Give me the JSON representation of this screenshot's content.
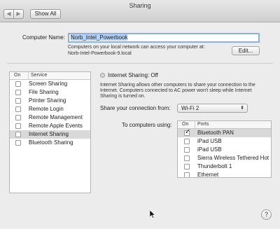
{
  "window": {
    "title": "Sharing",
    "nav_back": "◀",
    "nav_forward": "▶",
    "show_all": "Show All"
  },
  "computer_name": {
    "label": "Computer Name:",
    "value": "Norb_Intel_Powerbook",
    "info_line1": "Computers on your local network can access your computer at:",
    "info_line2": "Norb-Intel-Powerbook-9.local",
    "edit_button": "Edit..."
  },
  "service_list": {
    "headers": {
      "on": "On",
      "service": "Service"
    },
    "items": [
      {
        "label": "Screen Sharing",
        "checked": false,
        "selected": false
      },
      {
        "label": "File Sharing",
        "checked": false,
        "selected": false
      },
      {
        "label": "Printer Sharing",
        "checked": false,
        "selected": false
      },
      {
        "label": "Remote Login",
        "checked": false,
        "selected": false
      },
      {
        "label": "Remote Management",
        "checked": false,
        "selected": false
      },
      {
        "label": "Remote Apple Events",
        "checked": false,
        "selected": false
      },
      {
        "label": "Internet Sharing",
        "checked": false,
        "selected": true
      },
      {
        "label": "Bluetooth Sharing",
        "checked": false,
        "selected": false
      }
    ]
  },
  "detail": {
    "status": "Internet Sharing: Off",
    "description_line1": "Internet Sharing allows other computers to share your connection to the",
    "description_line2": "Internet. Computers connected to AC power won't sleep while Internet",
    "description_line3": "Sharing is turned on.",
    "share_from_label": "Share your connection from:",
    "share_from_value": "Wi-Fi 2",
    "to_computers_label": "To computers using:",
    "ports_headers": {
      "on": "On",
      "ports": "Ports"
    },
    "ports": [
      {
        "label": "Bluetooth PAN",
        "checked": true,
        "selected": true
      },
      {
        "label": "iPad USB",
        "checked": false,
        "selected": false
      },
      {
        "label": "iPad USB",
        "checked": false,
        "selected": false
      },
      {
        "label": "Sierra Wireless Tethered Hot",
        "checked": false,
        "selected": false
      },
      {
        "label": "Thunderbolt 1",
        "checked": false,
        "selected": false
      },
      {
        "label": "Ethernet",
        "checked": false,
        "selected": false
      }
    ]
  },
  "help_button": "?"
}
